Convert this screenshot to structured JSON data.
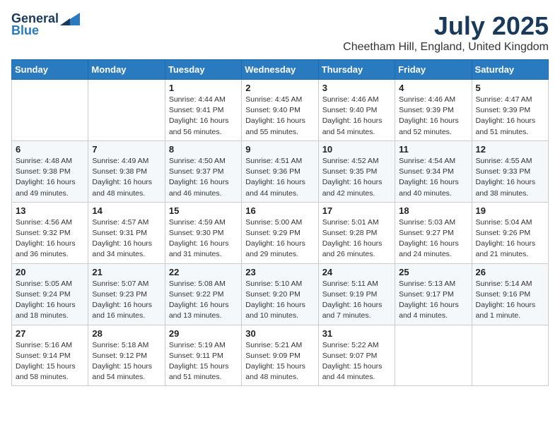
{
  "header": {
    "logo_general": "General",
    "logo_blue": "Blue",
    "month_title": "July 2025",
    "location": "Cheetham Hill, England, United Kingdom"
  },
  "days_of_week": [
    "Sunday",
    "Monday",
    "Tuesday",
    "Wednesday",
    "Thursday",
    "Friday",
    "Saturday"
  ],
  "weeks": [
    [
      {
        "day": "",
        "sunrise": "",
        "sunset": "",
        "daylight": ""
      },
      {
        "day": "",
        "sunrise": "",
        "sunset": "",
        "daylight": ""
      },
      {
        "day": "1",
        "sunrise": "Sunrise: 4:44 AM",
        "sunset": "Sunset: 9:41 PM",
        "daylight": "Daylight: 16 hours and 56 minutes."
      },
      {
        "day": "2",
        "sunrise": "Sunrise: 4:45 AM",
        "sunset": "Sunset: 9:40 PM",
        "daylight": "Daylight: 16 hours and 55 minutes."
      },
      {
        "day": "3",
        "sunrise": "Sunrise: 4:46 AM",
        "sunset": "Sunset: 9:40 PM",
        "daylight": "Daylight: 16 hours and 54 minutes."
      },
      {
        "day": "4",
        "sunrise": "Sunrise: 4:46 AM",
        "sunset": "Sunset: 9:39 PM",
        "daylight": "Daylight: 16 hours and 52 minutes."
      },
      {
        "day": "5",
        "sunrise": "Sunrise: 4:47 AM",
        "sunset": "Sunset: 9:39 PM",
        "daylight": "Daylight: 16 hours and 51 minutes."
      }
    ],
    [
      {
        "day": "6",
        "sunrise": "Sunrise: 4:48 AM",
        "sunset": "Sunset: 9:38 PM",
        "daylight": "Daylight: 16 hours and 49 minutes."
      },
      {
        "day": "7",
        "sunrise": "Sunrise: 4:49 AM",
        "sunset": "Sunset: 9:38 PM",
        "daylight": "Daylight: 16 hours and 48 minutes."
      },
      {
        "day": "8",
        "sunrise": "Sunrise: 4:50 AM",
        "sunset": "Sunset: 9:37 PM",
        "daylight": "Daylight: 16 hours and 46 minutes."
      },
      {
        "day": "9",
        "sunrise": "Sunrise: 4:51 AM",
        "sunset": "Sunset: 9:36 PM",
        "daylight": "Daylight: 16 hours and 44 minutes."
      },
      {
        "day": "10",
        "sunrise": "Sunrise: 4:52 AM",
        "sunset": "Sunset: 9:35 PM",
        "daylight": "Daylight: 16 hours and 42 minutes."
      },
      {
        "day": "11",
        "sunrise": "Sunrise: 4:54 AM",
        "sunset": "Sunset: 9:34 PM",
        "daylight": "Daylight: 16 hours and 40 minutes."
      },
      {
        "day": "12",
        "sunrise": "Sunrise: 4:55 AM",
        "sunset": "Sunset: 9:33 PM",
        "daylight": "Daylight: 16 hours and 38 minutes."
      }
    ],
    [
      {
        "day": "13",
        "sunrise": "Sunrise: 4:56 AM",
        "sunset": "Sunset: 9:32 PM",
        "daylight": "Daylight: 16 hours and 36 minutes."
      },
      {
        "day": "14",
        "sunrise": "Sunrise: 4:57 AM",
        "sunset": "Sunset: 9:31 PM",
        "daylight": "Daylight: 16 hours and 34 minutes."
      },
      {
        "day": "15",
        "sunrise": "Sunrise: 4:59 AM",
        "sunset": "Sunset: 9:30 PM",
        "daylight": "Daylight: 16 hours and 31 minutes."
      },
      {
        "day": "16",
        "sunrise": "Sunrise: 5:00 AM",
        "sunset": "Sunset: 9:29 PM",
        "daylight": "Daylight: 16 hours and 29 minutes."
      },
      {
        "day": "17",
        "sunrise": "Sunrise: 5:01 AM",
        "sunset": "Sunset: 9:28 PM",
        "daylight": "Daylight: 16 hours and 26 minutes."
      },
      {
        "day": "18",
        "sunrise": "Sunrise: 5:03 AM",
        "sunset": "Sunset: 9:27 PM",
        "daylight": "Daylight: 16 hours and 24 minutes."
      },
      {
        "day": "19",
        "sunrise": "Sunrise: 5:04 AM",
        "sunset": "Sunset: 9:26 PM",
        "daylight": "Daylight: 16 hours and 21 minutes."
      }
    ],
    [
      {
        "day": "20",
        "sunrise": "Sunrise: 5:05 AM",
        "sunset": "Sunset: 9:24 PM",
        "daylight": "Daylight: 16 hours and 18 minutes."
      },
      {
        "day": "21",
        "sunrise": "Sunrise: 5:07 AM",
        "sunset": "Sunset: 9:23 PM",
        "daylight": "Daylight: 16 hours and 16 minutes."
      },
      {
        "day": "22",
        "sunrise": "Sunrise: 5:08 AM",
        "sunset": "Sunset: 9:22 PM",
        "daylight": "Daylight: 16 hours and 13 minutes."
      },
      {
        "day": "23",
        "sunrise": "Sunrise: 5:10 AM",
        "sunset": "Sunset: 9:20 PM",
        "daylight": "Daylight: 16 hours and 10 minutes."
      },
      {
        "day": "24",
        "sunrise": "Sunrise: 5:11 AM",
        "sunset": "Sunset: 9:19 PM",
        "daylight": "Daylight: 16 hours and 7 minutes."
      },
      {
        "day": "25",
        "sunrise": "Sunrise: 5:13 AM",
        "sunset": "Sunset: 9:17 PM",
        "daylight": "Daylight: 16 hours and 4 minutes."
      },
      {
        "day": "26",
        "sunrise": "Sunrise: 5:14 AM",
        "sunset": "Sunset: 9:16 PM",
        "daylight": "Daylight: 16 hours and 1 minute."
      }
    ],
    [
      {
        "day": "27",
        "sunrise": "Sunrise: 5:16 AM",
        "sunset": "Sunset: 9:14 PM",
        "daylight": "Daylight: 15 hours and 58 minutes."
      },
      {
        "day": "28",
        "sunrise": "Sunrise: 5:18 AM",
        "sunset": "Sunset: 9:12 PM",
        "daylight": "Daylight: 15 hours and 54 minutes."
      },
      {
        "day": "29",
        "sunrise": "Sunrise: 5:19 AM",
        "sunset": "Sunset: 9:11 PM",
        "daylight": "Daylight: 15 hours and 51 minutes."
      },
      {
        "day": "30",
        "sunrise": "Sunrise: 5:21 AM",
        "sunset": "Sunset: 9:09 PM",
        "daylight": "Daylight: 15 hours and 48 minutes."
      },
      {
        "day": "31",
        "sunrise": "Sunrise: 5:22 AM",
        "sunset": "Sunset: 9:07 PM",
        "daylight": "Daylight: 15 hours and 44 minutes."
      },
      {
        "day": "",
        "sunrise": "",
        "sunset": "",
        "daylight": ""
      },
      {
        "day": "",
        "sunrise": "",
        "sunset": "",
        "daylight": ""
      }
    ]
  ]
}
